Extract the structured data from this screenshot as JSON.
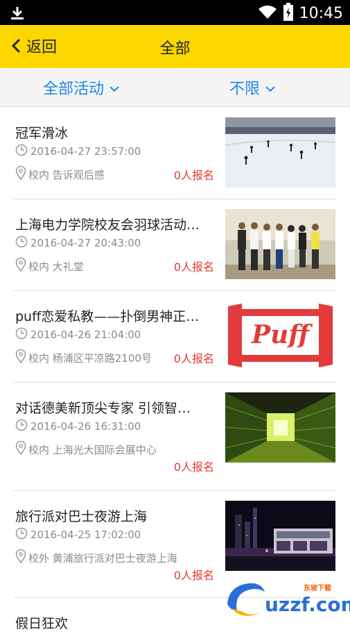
{
  "status_bar": {
    "time": "10:45"
  },
  "header": {
    "back_label": "返回",
    "title": "全部"
  },
  "filters": [
    {
      "label": "全部活动"
    },
    {
      "label": "不限"
    }
  ],
  "events": [
    {
      "title": "冠军滑冰",
      "time": "2016-04-27 23:57:00",
      "location": "校内 告诉观后感",
      "signups": "0人报名"
    },
    {
      "title": "上海电力学院校友会羽球活动…",
      "time": "2016-04-27 20:43:00",
      "location": "校内 大礼堂",
      "signups": "0人报名"
    },
    {
      "title": "puff恋爱私教——扑倒男神正…",
      "time": "2016-04-26 21:04:00",
      "location": "校内 杨浦区平凉路2100号",
      "signups": "0人报名",
      "thumb_text": "Puff"
    },
    {
      "title": "对话德美新顶尖专家 引领智…",
      "time": "2016-04-26 16:31:00",
      "location": "校内 上海光大国际会展中心",
      "signups": "0人报名"
    },
    {
      "title": "旅行派对巴士夜游上海",
      "time": "2016-04-25 17:02:00",
      "location": "校外 黄浦旅行派对巴士夜游上海",
      "signups": "0人报名"
    },
    {
      "title": "假日狂欢"
    }
  ],
  "watermark": {
    "text": "uzzf.com",
    "small": "东坡下载"
  }
}
